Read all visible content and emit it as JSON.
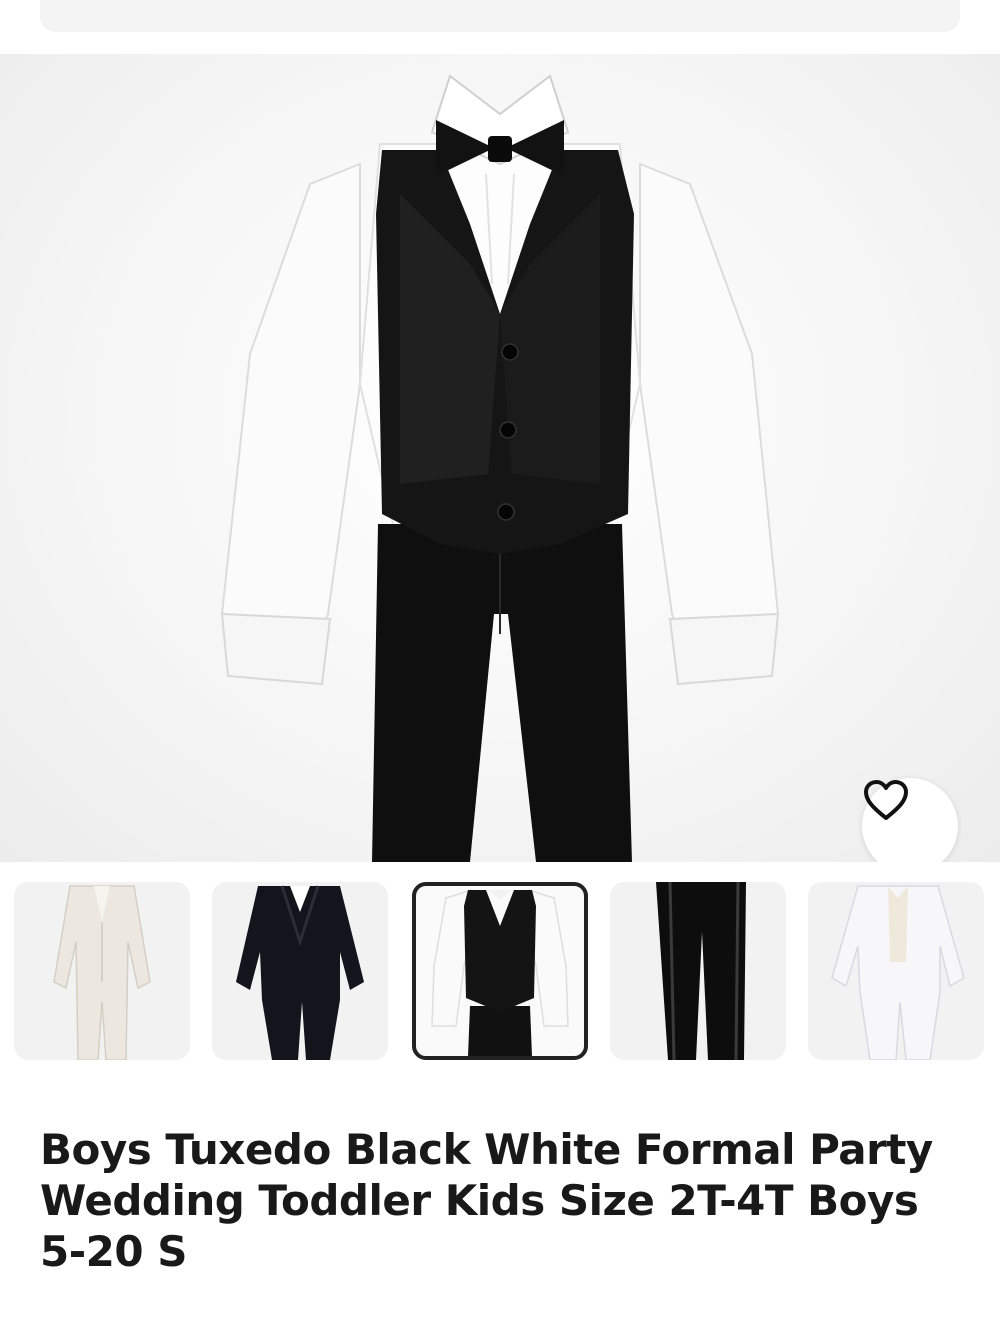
{
  "listing": {
    "title": "Boys Tuxedo Black White Formal Party Wedding Toddler Kids Size 2T-4T Boys 5-20 S"
  },
  "gallery": {
    "main_image": "black-vest-white-shirt-bow-tie-outfit",
    "selected_index": 2,
    "thumbnails": [
      "ivory-suit",
      "black-tuxedo-jacket",
      "black-vest-white-shirt",
      "black-pants-satin-stripe",
      "white-tuxedo"
    ]
  },
  "icons": {
    "favorite": "heart-outline-icon"
  },
  "colors": {
    "text": "#191919",
    "selected_border": "#222222"
  }
}
